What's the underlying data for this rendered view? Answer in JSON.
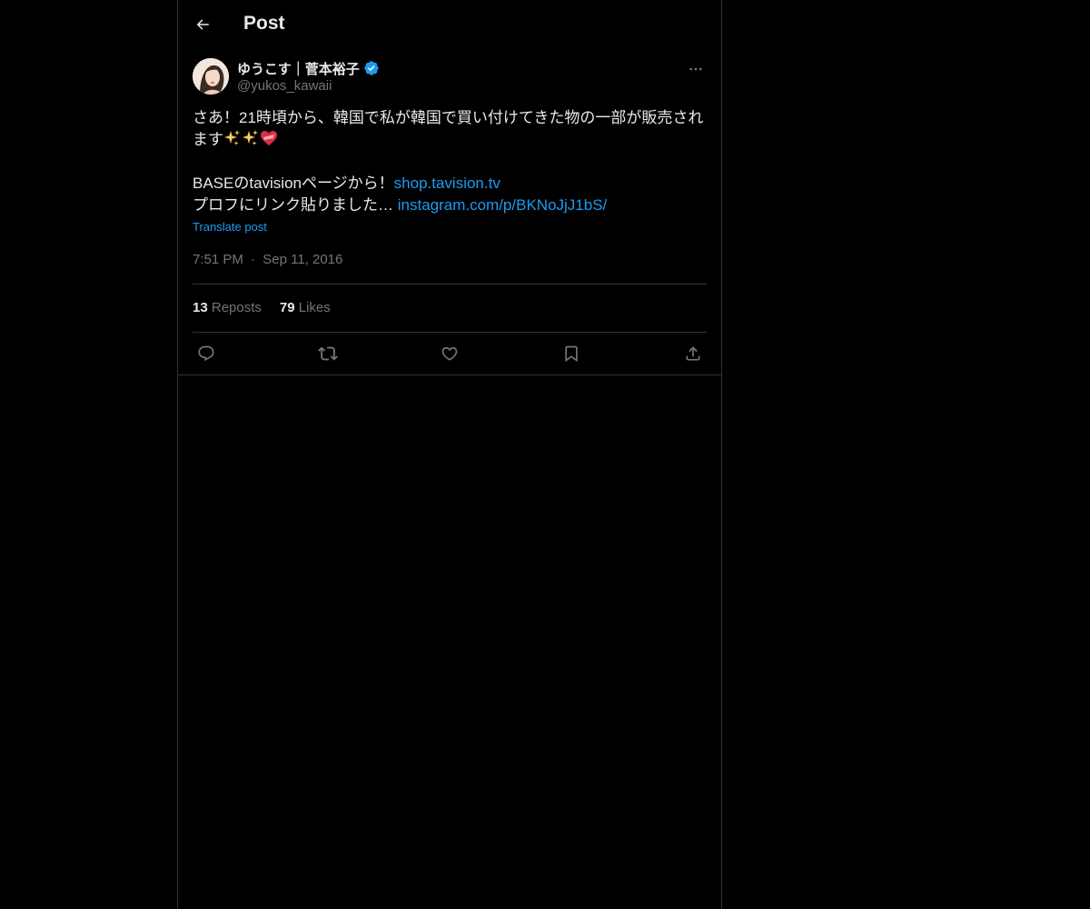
{
  "header": {
    "back_icon": "arrow-left-icon",
    "title": "Post"
  },
  "post": {
    "author": {
      "name": "ゆうこす｜菅本裕子",
      "handle": "@yukos_kawaii",
      "verified": true,
      "verified_color": "#1d9bf0"
    },
    "body": {
      "line1": "さあ！21時頃から、韓国で私が韓国で買い付けてきた物の一部が販売され",
      "line2": "ます",
      "line2_emojis": [
        "sparkles",
        "sparkles",
        "heart-with-ribbon"
      ],
      "line4_text": "BASEのtavisionページから！",
      "line4_link": "shop.tavision.tv",
      "line5_text": "プロフにリンク貼りました…",
      "line5_link": "instagram.com/p/BKNoJjJ1bS/"
    },
    "translate_label": "Translate post",
    "timestamp": {
      "time": "7:51 PM",
      "separator": "·",
      "date": "Sep 11, 2016"
    },
    "stats": {
      "reposts_count": "13",
      "reposts_label": "Reposts",
      "likes_count": "79",
      "likes_label": "Likes"
    },
    "actions": [
      "reply-icon",
      "repost-icon",
      "like-icon",
      "bookmark-icon",
      "share-icon"
    ]
  },
  "colors": {
    "background": "#000000",
    "text": "#e7e9ea",
    "muted": "#71767b",
    "link": "#1d9bf0",
    "border": "#2f3336"
  }
}
